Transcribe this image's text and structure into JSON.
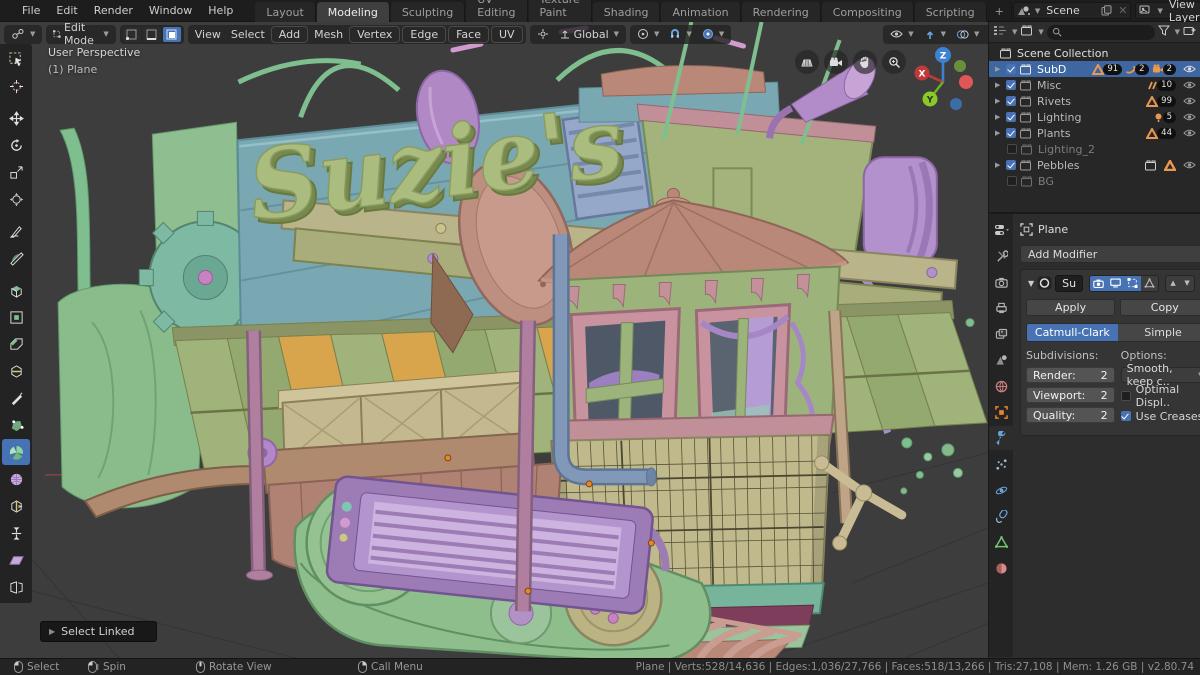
{
  "topbar": {
    "menus": [
      "File",
      "Edit",
      "Render",
      "Window",
      "Help"
    ],
    "tabs": [
      "Layout",
      "Modeling",
      "Sculpting",
      "UV Editing",
      "Texture Paint",
      "Shading",
      "Animation",
      "Rendering",
      "Compositing",
      "Scripting"
    ],
    "add_tab": "+",
    "scene_label": "Scene",
    "view_layer_label": "View Layer"
  },
  "viewport": {
    "mode": "Edit Mode",
    "menus": [
      "View",
      "Select",
      "Add",
      "Mesh",
      "Vertex",
      "Edge",
      "Face",
      "UV"
    ],
    "orientation": "Global",
    "overlay_perspective": "User Perspective",
    "overlay_object": "(1) Plane",
    "operator_panel": "Select Linked",
    "axis": {
      "x": "X",
      "y": "Y",
      "z": "Z"
    },
    "model": {
      "sign_text": "Suzie's"
    }
  },
  "outliner": {
    "root": "Scene Collection",
    "items": [
      {
        "label": "SubD",
        "badges": [
          "91",
          "2",
          "2"
        ]
      },
      {
        "label": "Misc",
        "badges": [
          "10"
        ]
      },
      {
        "label": "Rivets",
        "badges": [
          "99"
        ]
      },
      {
        "label": "Lighting",
        "badges": [
          "5"
        ]
      },
      {
        "label": "Plants",
        "badges": [
          "44"
        ]
      },
      {
        "label": "Lighting_2",
        "badges": []
      },
      {
        "label": "Pebbles",
        "badges": []
      },
      {
        "label": "BG",
        "badges": []
      }
    ]
  },
  "properties": {
    "object_name": "Plane",
    "add_modifier": "Add Modifier",
    "modifier": {
      "name": "Su",
      "apply": "Apply",
      "copy": "Copy",
      "type_catmull": "Catmull-Clark",
      "type_simple": "Simple",
      "subdivisions_label": "Subdivisions:",
      "options_label": "Options:",
      "render_label": "Render:",
      "render_value": "2",
      "viewport_label": "Viewport:",
      "viewport_value": "2",
      "quality_label": "Quality:",
      "quality_value": "2",
      "uv_smooth": "Smooth, keep c..",
      "optimal_display": "Optimal Displ..",
      "use_creases": "Use Creases"
    }
  },
  "statusbar": {
    "select": "Select",
    "spin": "Spin",
    "rotate_view": "Rotate View",
    "call_menu": "Call Menu",
    "stats": "Plane | Verts:528/14,636 | Edges:1,036/27,766 | Faces:518/13,266 | Tris:27,108 | Mem: 1.26 GB | v2.80.74"
  },
  "colors": {
    "accent": "#4772b3",
    "selection_row": "#3e66a0",
    "origin_orange": "#e6862e",
    "viewport_bg": "#3d3d3d"
  }
}
